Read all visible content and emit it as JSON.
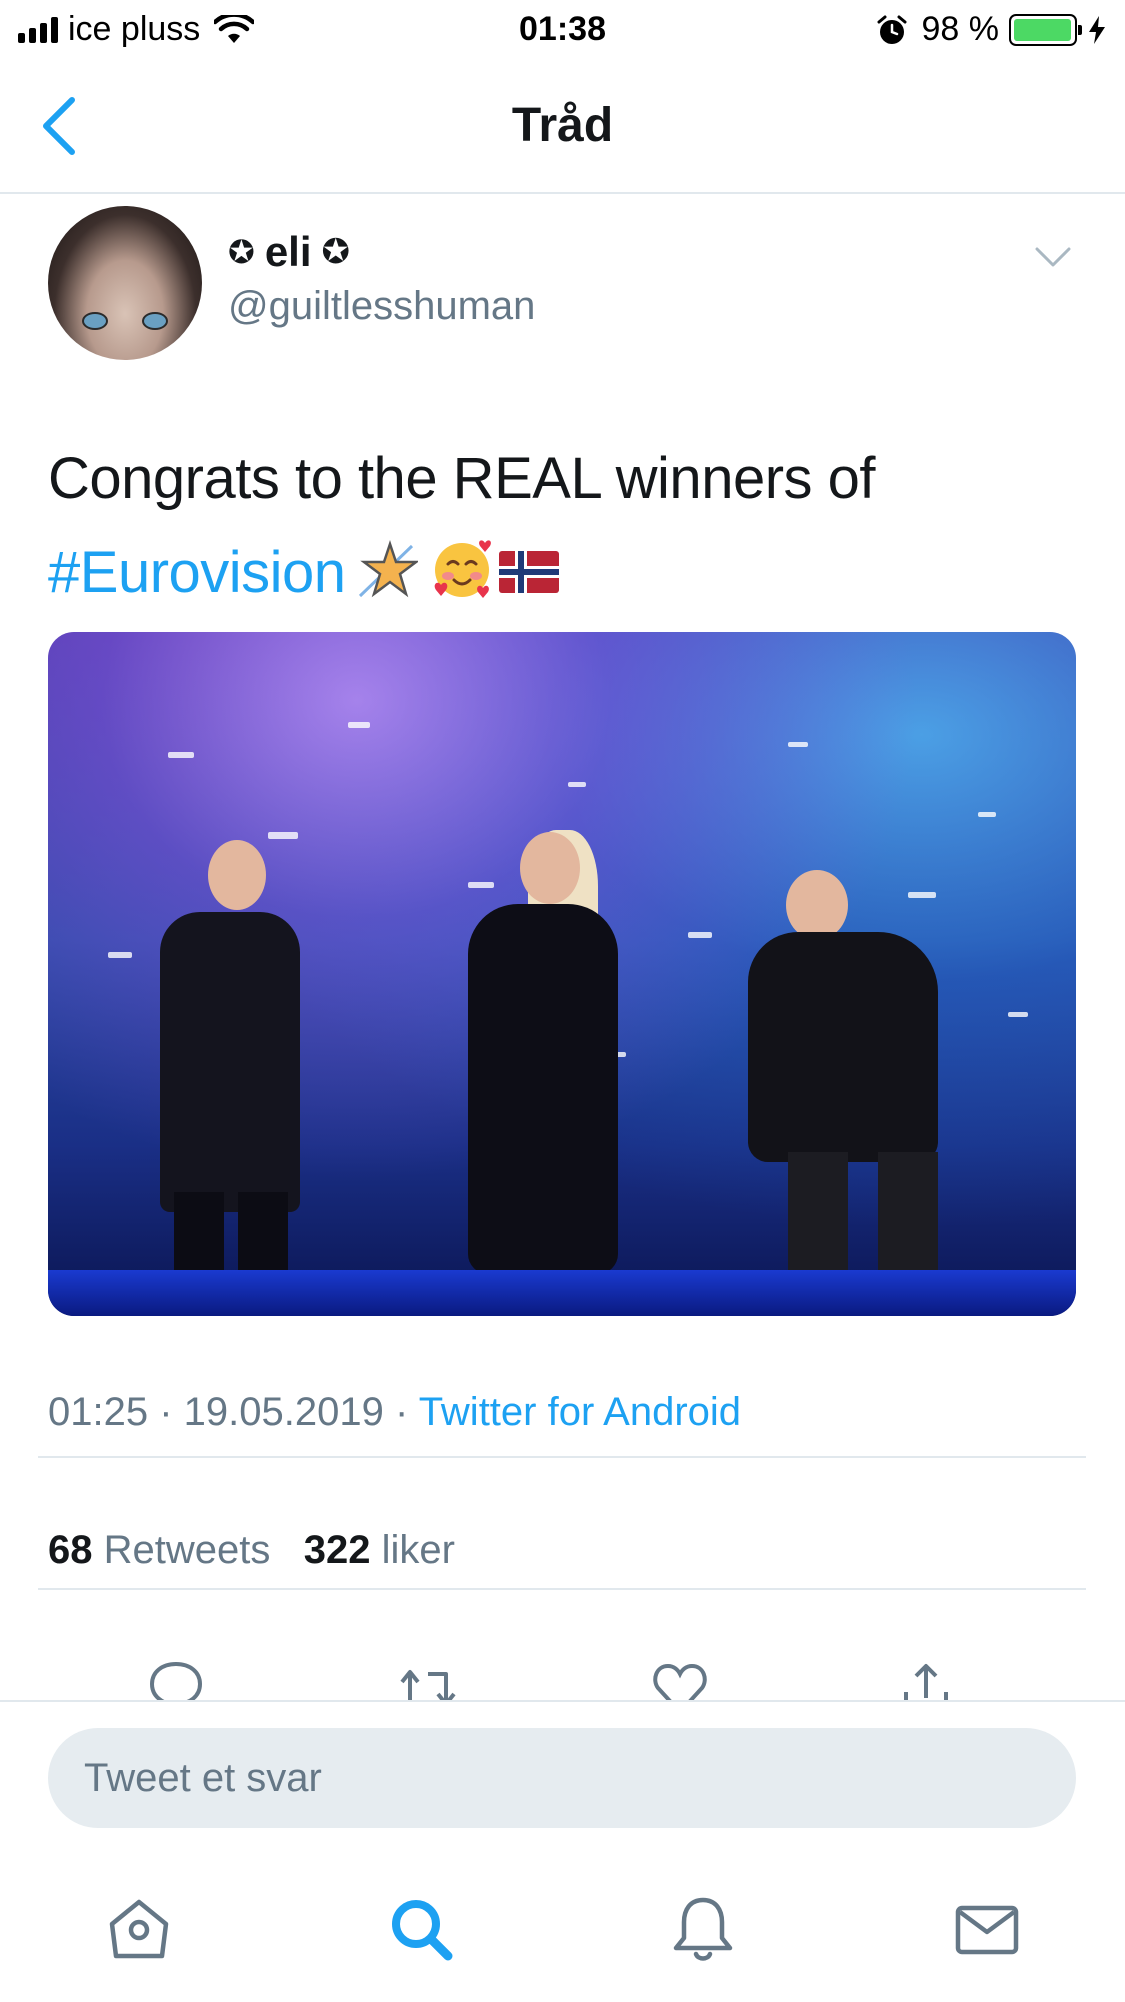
{
  "status_bar": {
    "carrier": "ice pluss",
    "time": "01:38",
    "battery_percent": "98 %",
    "battery_level": 0.98,
    "icons": [
      "signal-icon",
      "wifi-icon",
      "alarm-icon",
      "battery-icon",
      "charging-bolt-icon"
    ]
  },
  "nav": {
    "title": "Tråd",
    "back_icon": "chevron-left-icon"
  },
  "tweet": {
    "author": {
      "name_prefix": "✪",
      "display_name": "eli",
      "name_suffix": "✪",
      "handle": "@guiltlesshuman"
    },
    "text_line1": "Congrats to the REAL winners of",
    "hashtag": "#Eurovision",
    "emojis": [
      "shooting-star-emoji",
      "smiling-face-with-hearts-emoji",
      "norway-flag-emoji"
    ],
    "meta": {
      "time": "01:25",
      "separator1": " · ",
      "date": "19.05.2019",
      "separator2": " · ",
      "source": "Twitter for Android"
    },
    "stats": {
      "retweets_count": "68",
      "retweets_label": " Retweets",
      "likes_count": "322",
      "likes_label": " liker"
    },
    "actions": [
      "reply-icon",
      "retweet-icon",
      "like-icon",
      "share-icon"
    ]
  },
  "reply": {
    "placeholder": "Tweet et svar"
  },
  "tab_bar": {
    "tabs": [
      "home-icon",
      "search-icon",
      "notifications-icon",
      "messages-icon"
    ],
    "active": "search-icon"
  },
  "colors": {
    "accent": "#1da1f2",
    "secondary_text": "#657786",
    "divider": "#e1e8ed",
    "battery_fill": "#4cd964"
  }
}
